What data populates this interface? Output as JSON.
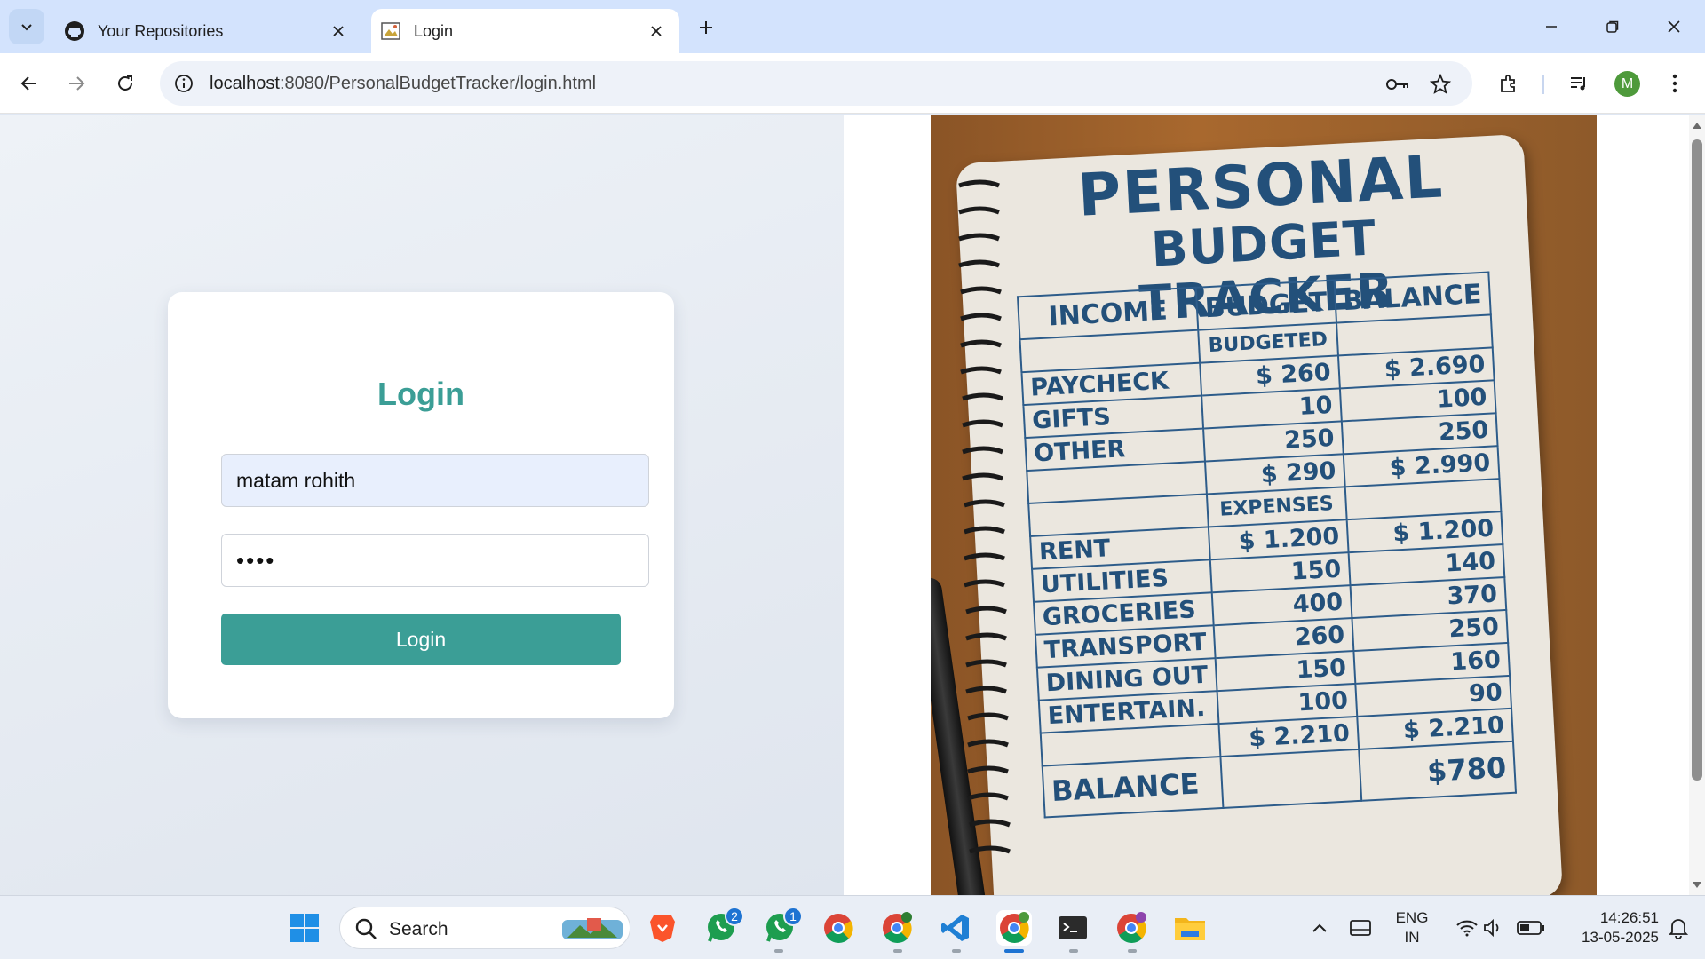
{
  "browser": {
    "tabs": [
      {
        "title": "Your Repositories",
        "icon": "github-icon"
      },
      {
        "title": "Login",
        "icon": "broken-image-icon"
      }
    ],
    "url": {
      "host": "localhost",
      "path": ":8080/PersonalBudgetTracker/login.html"
    },
    "profile_initial": "M"
  },
  "login": {
    "heading": "Login",
    "username_value": "matam rohith",
    "password_masked": "••••",
    "button_label": "Login"
  },
  "illustration": {
    "title_line1": "PERSONAL",
    "title_line2": "BUDGET TRACKER",
    "headers": [
      "INCOME",
      "BUDGET",
      "BALANCE"
    ],
    "sub_budgeted": "BUDGETED",
    "income_rows": [
      {
        "label": "PAYCHECK",
        "budget": "$ 260",
        "balance": "$ 2.690"
      },
      {
        "label": "GIFTS",
        "budget": "10",
        "balance": "100"
      },
      {
        "label": "OTHER",
        "budget": "250",
        "balance": "250"
      }
    ],
    "income_total": {
      "budget": "$ 290",
      "balance": "$ 2.990"
    },
    "sub_expenses": "EXPENSES",
    "expense_rows": [
      {
        "label": "RENT",
        "budget": "$ 1.200",
        "balance": "$ 1.200"
      },
      {
        "label": "UTILITIES",
        "budget": "150",
        "balance": "140"
      },
      {
        "label": "GROCERIES",
        "budget": "400",
        "balance": "370"
      },
      {
        "label": "TRANSPORT",
        "budget": "260",
        "balance": "250"
      },
      {
        "label": "DINING OUT",
        "budget": "150",
        "balance": "160"
      },
      {
        "label": "ENTERTAIN.",
        "budget": "100",
        "balance": "90"
      }
    ],
    "expense_total": {
      "budget": "$ 2.210",
      "balance": "$ 2.210"
    },
    "balance_label": "BALANCE",
    "balance_value": "$780"
  },
  "taskbar": {
    "search_label": "Search",
    "whatsapp_badge": "2",
    "whatsapp_beta_badge": "1",
    "lang_line1": "ENG",
    "lang_line2": "IN",
    "time": "14:26:51",
    "date": "13-05-2025"
  },
  "colors": {
    "accent": "#3b9e96",
    "ink": "#23507a",
    "avatar": "#4e9a3b"
  }
}
